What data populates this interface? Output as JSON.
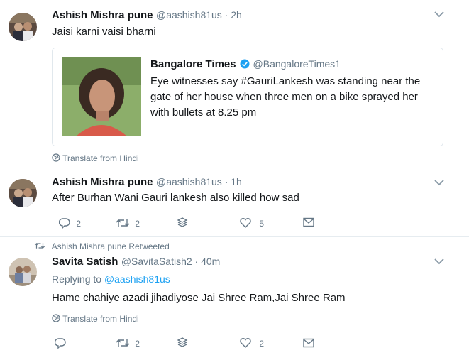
{
  "tweet1": {
    "name": "Ashish Mishra pune",
    "handle": "@aashish81us · 2h",
    "text": "Jaisi karni vaisi bharni",
    "quote": {
      "name": "Bangalore Times",
      "handle": "@BangaloreTimes1",
      "text_line1": "Eye witnesses say #GauriLankesh was standing near the",
      "text_line2": "gate of her house when three men on a bike sprayed her",
      "text_line3": "with bullets at 8.25 pm"
    },
    "translate": "Translate from Hindi"
  },
  "tweet2": {
    "name": "Ashish Mishra pune",
    "handle": "@aashish81us · 1h",
    "text": "After Burhan Wani  Gauri lankesh also killed how sad",
    "replies": "2",
    "retweets": "2",
    "likes": "5"
  },
  "retweeted_by": "Ashish Mishra pune Retweeted",
  "tweet3": {
    "name": "Savita Satish",
    "handle": "@SavitaSatish2 · 40m",
    "replying_prefix": "Replying to ",
    "replying_to": "@aashish81us",
    "text": "Hame chahiye azadi jihadiyose Jai Shree Ram,Jai Shree Ram",
    "translate": "Translate from Hindi",
    "retweets": "2",
    "likes": "2"
  },
  "icons": {
    "reply": "reply-icon",
    "retweet": "retweet-icon",
    "stack": "stack-icon",
    "like": "heart-icon",
    "dm": "envelope-icon",
    "chevron": "chevron-down-icon",
    "globe": "globe-icon",
    "verified": "verified-badge-icon"
  },
  "colors": {
    "accent": "#1da1f2",
    "muted": "#657786",
    "text": "#14171a"
  }
}
